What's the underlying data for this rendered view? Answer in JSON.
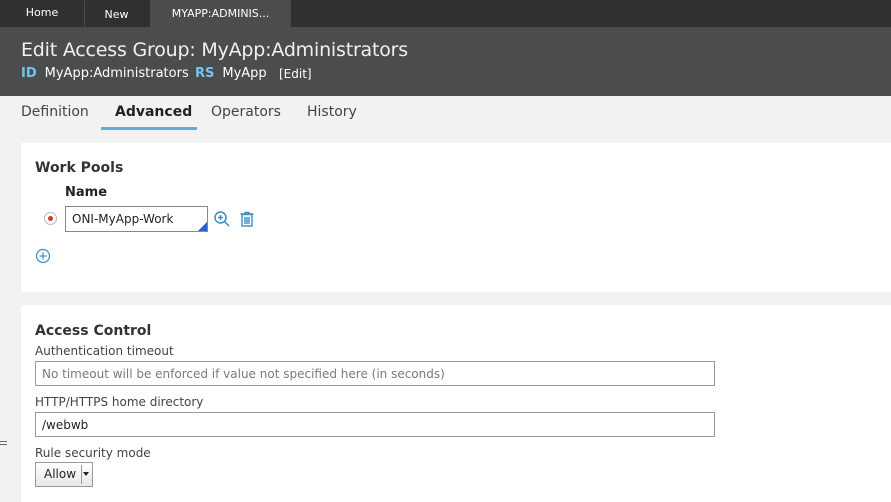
{
  "doc_tabs": [
    {
      "label": "Home"
    },
    {
      "label": "New"
    },
    {
      "label": "MYAPP:ADMINIS..."
    }
  ],
  "header": {
    "title": "Edit Access Group: MyApp:Administrators",
    "id_key": "ID",
    "id_value": "MyApp:Administrators",
    "rs_key": "RS",
    "rs_value": "MyApp",
    "edit_label": "[Edit]"
  },
  "subtabs": [
    {
      "label": "Definition"
    },
    {
      "label": "Advanced"
    },
    {
      "label": "Operators"
    },
    {
      "label": "History"
    }
  ],
  "work_pools": {
    "title": "Work Pools",
    "column_header": "Name",
    "rows": [
      {
        "name": "ONI-MyApp-Work",
        "default": true
      }
    ],
    "icons": {
      "search": "zoom-icon",
      "delete": "trash-icon",
      "add": "add-circle-icon"
    }
  },
  "access_control": {
    "title": "Access Control",
    "auth_timeout_label": "Authentication timeout",
    "auth_timeout_value": "",
    "auth_timeout_placeholder": "No timeout will be enforced if value not specified here (in seconds)",
    "home_dir_label": "HTTP/HTTPS home directory",
    "home_dir_value": "/webwb",
    "rule_security_label": "Rule security mode",
    "rule_security_value": "Allow"
  },
  "colors": {
    "tab_bar": "#2f3030",
    "header_bg": "#4b4c4e",
    "accent": "#5baee0",
    "key_label": "#72c6ef",
    "icon": "#3b8bc4",
    "radio_dot": "#d9382a"
  }
}
